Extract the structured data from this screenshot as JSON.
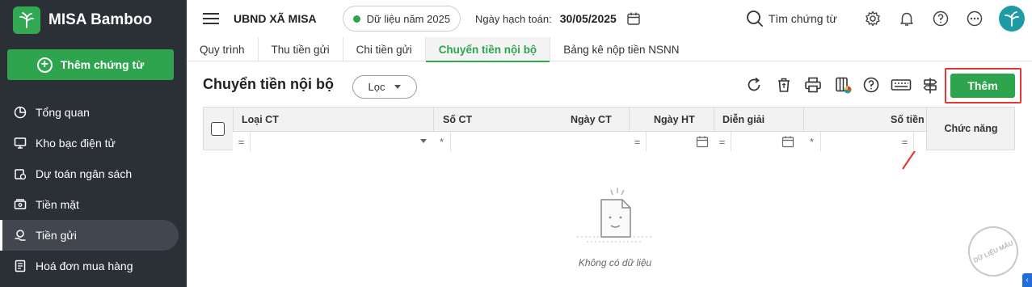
{
  "brand": {
    "name": "MISA Bamboo"
  },
  "sidebar": {
    "add_label": "Thêm chứng từ",
    "items": [
      {
        "label": "Tổng quan",
        "icon": "pie-chart-icon"
      },
      {
        "label": "Kho bạc điện tử",
        "icon": "monitor-icon"
      },
      {
        "label": "Dự toán ngân sách",
        "icon": "budget-icon"
      },
      {
        "label": "Tiền mặt",
        "icon": "cash-icon"
      },
      {
        "label": "Tiền gửi",
        "icon": "deposit-icon",
        "active": true
      },
      {
        "label": "Hoá đơn mua hàng",
        "icon": "invoice-icon"
      }
    ]
  },
  "header": {
    "org": "UBND XÃ MISA",
    "year_label": "Dữ liệu năm 2025",
    "date_label": "Ngày hạch toán:",
    "date_value": "30/05/2025",
    "search_label": "Tìm chứng từ"
  },
  "tabs": [
    {
      "label": "Quy trình"
    },
    {
      "label": "Thu tiền gửi"
    },
    {
      "label": "Chi tiền gửi"
    },
    {
      "label": "Chuyển tiền nội bộ",
      "active": true
    },
    {
      "label": "Bảng kê nộp tiền NSNN"
    }
  ],
  "page": {
    "title": "Chuyển tiền nội bộ",
    "filter_label": "Lọc",
    "add_label": "Thêm"
  },
  "table": {
    "columns": [
      "Loại CT",
      "Số CT",
      "Ngày CT",
      "Ngày HT",
      "Diễn giải",
      "Số tiền",
      "Chức năng"
    ],
    "filter_ops": [
      "=",
      "*",
      "=",
      "=",
      "*",
      "="
    ],
    "empty_text": "Không có dữ liệu"
  },
  "watermark": {
    "text": "DỮ LIỆU MẪU"
  },
  "colors": {
    "accent": "#2ea44f",
    "sidebar": "#2b2f36",
    "highlight": "#e53935"
  }
}
